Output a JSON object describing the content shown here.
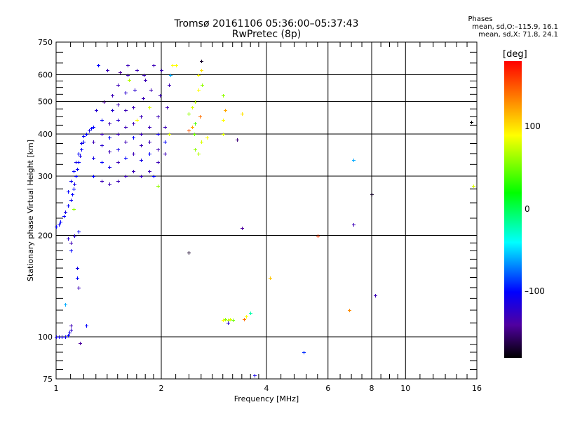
{
  "header": {
    "title": "Tromsø 20161106 05:36:00–05:37:43",
    "subtitle": "RwPretec (8p)",
    "stats_title": "Phases",
    "stats_o": "mean, sd,O:–115.9, 16.1",
    "stats_x": "mean, sd,X:  71.8, 24.1"
  },
  "colorbar": {
    "unit": "[deg]",
    "range": [
      -180,
      180
    ],
    "ticks": [
      {
        "v": 100,
        "label": "100"
      },
      {
        "v": 0,
        "label": "0"
      },
      {
        "v": -100,
        "label": "–100"
      }
    ]
  },
  "chart_data": {
    "type": "scatter",
    "title": "Tromsø 20161106 05:36:00–05:37:43",
    "xlabel": "Frequency [MHz]",
    "ylabel": "Stationary phase Virtual Height [km]",
    "xscale": "log",
    "yscale": "log",
    "xlim": [
      1,
      16
    ],
    "ylim": [
      75,
      750
    ],
    "xticks": [
      1,
      2,
      4,
      6,
      8,
      10,
      16
    ],
    "yticks": [
      75,
      100,
      200,
      300,
      400,
      500,
      600,
      750
    ],
    "xgrid": [
      2,
      4,
      6,
      8,
      10
    ],
    "ygrid": [
      100,
      200,
      300,
      400,
      500,
      600
    ],
    "point_fields": [
      "freq_MHz",
      "height_km",
      "phase_deg"
    ],
    "points": [
      [
        1.0,
        100,
        -110
      ],
      [
        1.02,
        100,
        -105
      ],
      [
        1.04,
        100,
        -110
      ],
      [
        1.06,
        100,
        -105
      ],
      [
        1.08,
        101,
        -100
      ],
      [
        1.09,
        103,
        -110
      ],
      [
        1.1,
        105,
        -120
      ],
      [
        1.1,
        108,
        -130
      ],
      [
        1.17,
        96,
        -140
      ],
      [
        1.06,
        125,
        -60
      ],
      [
        1.22,
        108,
        -100
      ],
      [
        1.0,
        212,
        -100
      ],
      [
        1.02,
        215,
        -105
      ],
      [
        1.03,
        220,
        -100
      ],
      [
        1.05,
        228,
        -100
      ],
      [
        1.06,
        235,
        -110
      ],
      [
        1.08,
        245,
        -100
      ],
      [
        1.1,
        255,
        -105
      ],
      [
        1.11,
        265,
        -100
      ],
      [
        1.12,
        275,
        -100
      ],
      [
        1.13,
        285,
        -110
      ],
      [
        1.14,
        300,
        -100
      ],
      [
        1.15,
        315,
        -105
      ],
      [
        1.16,
        330,
        -100
      ],
      [
        1.17,
        345,
        -110
      ],
      [
        1.18,
        360,
        -100
      ],
      [
        1.2,
        380,
        -105
      ],
      [
        1.22,
        400,
        -100
      ],
      [
        1.24,
        410,
        -110
      ],
      [
        1.26,
        415,
        -100
      ],
      [
        1.08,
        270,
        -100
      ],
      [
        1.1,
        290,
        -105
      ],
      [
        1.12,
        310,
        -100
      ],
      [
        1.14,
        330,
        -110
      ],
      [
        1.16,
        350,
        -100
      ],
      [
        1.18,
        375,
        -110
      ],
      [
        1.2,
        395,
        -100
      ],
      [
        1.13,
        200,
        -120
      ],
      [
        1.16,
        205,
        -100
      ],
      [
        1.1,
        190,
        -130
      ],
      [
        1.1,
        180,
        -100
      ],
      [
        1.15,
        160,
        -110
      ],
      [
        1.15,
        150,
        -100
      ],
      [
        1.16,
        140,
        -130
      ],
      [
        1.12,
        240,
        60
      ],
      [
        1.08,
        196,
        -120
      ],
      [
        1.28,
        300,
        -100
      ],
      [
        1.28,
        340,
        -110
      ],
      [
        1.28,
        380,
        -130
      ],
      [
        1.28,
        420,
        -100
      ],
      [
        1.3,
        470,
        -120
      ],
      [
        1.32,
        640,
        -100
      ],
      [
        1.35,
        290,
        -130
      ],
      [
        1.35,
        330,
        -100
      ],
      [
        1.35,
        370,
        -120
      ],
      [
        1.35,
        400,
        -130
      ],
      [
        1.35,
        440,
        -100
      ],
      [
        1.37,
        500,
        -140
      ],
      [
        1.4,
        620,
        -130
      ],
      [
        1.42,
        285,
        -130
      ],
      [
        1.42,
        320,
        -110
      ],
      [
        1.42,
        355,
        -130
      ],
      [
        1.42,
        390,
        -100
      ],
      [
        1.42,
        430,
        -130
      ],
      [
        1.45,
        470,
        -120
      ],
      [
        1.45,
        520,
        -130
      ],
      [
        1.5,
        290,
        -130
      ],
      [
        1.5,
        330,
        -130
      ],
      [
        1.5,
        360,
        -110
      ],
      [
        1.5,
        400,
        -130
      ],
      [
        1.5,
        440,
        -120
      ],
      [
        1.5,
        490,
        -130
      ],
      [
        1.5,
        560,
        -130
      ],
      [
        1.52,
        610,
        -140
      ],
      [
        1.58,
        300,
        -130
      ],
      [
        1.58,
        340,
        -100
      ],
      [
        1.58,
        380,
        -130
      ],
      [
        1.58,
        420,
        -130
      ],
      [
        1.58,
        470,
        -130
      ],
      [
        1.58,
        530,
        -120
      ],
      [
        1.6,
        600,
        -130
      ],
      [
        1.6,
        640,
        -130
      ],
      [
        1.62,
        580,
        70
      ],
      [
        1.66,
        310,
        -130
      ],
      [
        1.66,
        350,
        -130
      ],
      [
        1.66,
        390,
        -100
      ],
      [
        1.66,
        430,
        -130
      ],
      [
        1.66,
        480,
        -130
      ],
      [
        1.68,
        540,
        -120
      ],
      [
        1.7,
        620,
        -130
      ],
      [
        1.7,
        440,
        90
      ],
      [
        1.75,
        300,
        -130
      ],
      [
        1.75,
        335,
        -110
      ],
      [
        1.75,
        370,
        -130
      ],
      [
        1.75,
        400,
        -130
      ],
      [
        1.75,
        450,
        -130
      ],
      [
        1.77,
        510,
        -130
      ],
      [
        1.8,
        580,
        -130
      ],
      [
        1.78,
        600,
        -130
      ],
      [
        1.85,
        310,
        -130
      ],
      [
        1.85,
        350,
        -100
      ],
      [
        1.85,
        380,
        -130
      ],
      [
        1.85,
        420,
        -130
      ],
      [
        1.85,
        480,
        80
      ],
      [
        1.87,
        540,
        -130
      ],
      [
        1.9,
        640,
        -130
      ],
      [
        1.9,
        300,
        -100
      ],
      [
        1.95,
        330,
        -130
      ],
      [
        1.95,
        360,
        -130
      ],
      [
        1.95,
        400,
        -110
      ],
      [
        1.95,
        450,
        -130
      ],
      [
        1.98,
        520,
        -130
      ],
      [
        1.95,
        280,
        60
      ],
      [
        2.0,
        620,
        -130
      ],
      [
        2.05,
        350,
        -130
      ],
      [
        2.05,
        380,
        -100
      ],
      [
        2.05,
        420,
        -130
      ],
      [
        2.08,
        480,
        -130
      ],
      [
        2.1,
        560,
        -130
      ],
      [
        2.12,
        600,
        -60
      ],
      [
        2.1,
        400,
        80
      ],
      [
        2.15,
        640,
        90
      ],
      [
        2.4,
        460,
        60
      ],
      [
        2.45,
        480,
        80
      ],
      [
        2.5,
        500,
        70
      ],
      [
        2.55,
        540,
        90
      ],
      [
        2.5,
        430,
        40
      ],
      [
        2.48,
        400,
        50
      ],
      [
        2.5,
        360,
        60
      ],
      [
        2.55,
        350,
        70
      ],
      [
        2.6,
        380,
        80
      ],
      [
        2.55,
        600,
        90
      ],
      [
        2.6,
        620,
        100
      ],
      [
        2.45,
        420,
        120
      ],
      [
        2.7,
        390,
        90
      ],
      [
        2.58,
        450,
        140
      ],
      [
        2.62,
        560,
        60
      ],
      [
        2.4,
        410,
        150
      ],
      [
        3.0,
        520,
        60
      ],
      [
        3.0,
        440,
        90
      ],
      [
        3.05,
        470,
        120
      ],
      [
        3.0,
        400,
        80
      ],
      [
        3.4,
        460,
        100
      ],
      [
        3.3,
        385,
        -150
      ],
      [
        2.2,
        640,
        90
      ],
      [
        2.6,
        660,
        -170
      ],
      [
        3.0,
        112,
        90
      ],
      [
        3.05,
        113,
        60
      ],
      [
        3.1,
        112,
        70
      ],
      [
        3.15,
        113,
        80
      ],
      [
        3.2,
        112,
        50
      ],
      [
        3.1,
        110,
        -120
      ],
      [
        3.45,
        113,
        140
      ],
      [
        3.5,
        115,
        90
      ],
      [
        3.6,
        118,
        -20
      ],
      [
        3.7,
        77,
        -110
      ],
      [
        3.4,
        210,
        -140
      ],
      [
        4.1,
        150,
        110
      ],
      [
        5.1,
        90,
        -90
      ],
      [
        5.6,
        200,
        160
      ],
      [
        6.9,
        120,
        130
      ],
      [
        7.1,
        335,
        -60
      ],
      [
        7.1,
        215,
        -130
      ],
      [
        8.0,
        265,
        -170
      ],
      [
        8.2,
        133,
        -130
      ],
      [
        15.4,
        435,
        -180
      ],
      [
        15.6,
        280,
        80
      ],
      [
        2.4,
        178,
        -170
      ]
    ]
  }
}
